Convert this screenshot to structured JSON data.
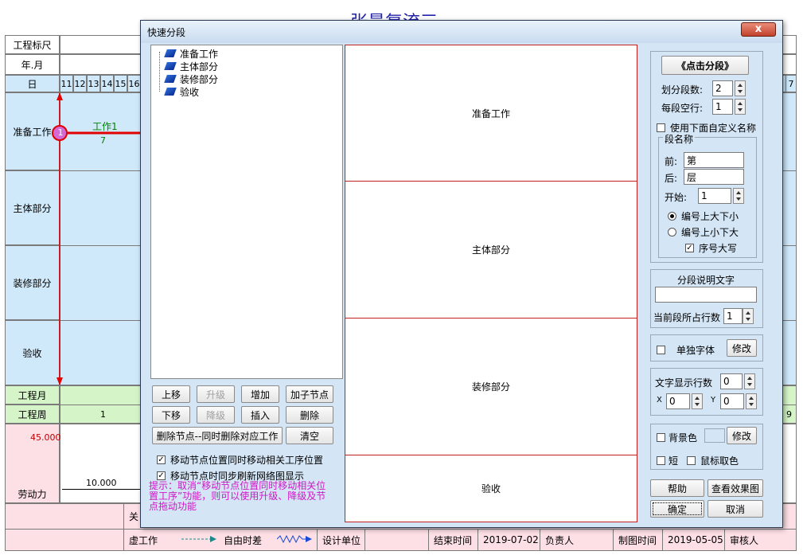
{
  "background": {
    "title": "张最复流三",
    "row_labels": [
      "工程标尺",
      "年.月",
      "日",
      "准备工作",
      "主体部分",
      "装修部分",
      "验收",
      "工程月",
      "工程周",
      "劳动力"
    ],
    "day_numbers": [
      "11",
      "12",
      "13",
      "14",
      "15",
      "16"
    ],
    "right_day": "7",
    "task": {
      "name": "工作1",
      "duration": "7",
      "node": "1"
    },
    "week_first": "1",
    "week_right": "9",
    "labor_max": "45.000",
    "labor_line": "10.000",
    "footer_left": "关",
    "footer": {
      "virtual_work": "虚工作",
      "free_float": "自由时差",
      "design_unit": "设计单位",
      "end_time_label": "结束时间",
      "end_time": "2019-07-02",
      "owner": "负责人",
      "draw_time_label": "制图时间",
      "draw_time": "2019-05-05",
      "reviewer": "审核人"
    }
  },
  "dialog": {
    "title": "快速分段",
    "close_label": "x",
    "tree_items": [
      "准备工作",
      "主体部分",
      "装修部分",
      "验收"
    ],
    "buttons": {
      "move_up": "上移",
      "upgrade": "升级",
      "add": "增加",
      "add_child": "加子节点",
      "move_down": "下移",
      "downgrade": "降级",
      "insert": "插入",
      "delete": "删除",
      "delete_node_work": "删除节点--同时删除对应工作",
      "clear": "清空"
    },
    "check_move_node": "移动节点位置同时移动相关工序位置",
    "check_sync_refresh": "移动节点时同步刷新网络图显示",
    "hint": "提示：取消“移动节点位置同时移动相关位置工序”功能，则可以使用升级、降级及节点拖动功能",
    "preview_segments": [
      "准备工作",
      "主体部分",
      "装修部分",
      "验收"
    ],
    "right": {
      "click_segment": "《点击分段》",
      "segments_label": "划分段数:",
      "segments_value": "2",
      "blank_rows_label": "每段空行:",
      "blank_rows_value": "1",
      "use_custom_names": "使用下面自定义名称",
      "segment_name_group": "段名称",
      "prefix_label": "前:",
      "prefix_value": "第",
      "suffix_label": "后:",
      "suffix_value": "层",
      "start_label": "开始:",
      "start_value": "1",
      "radio_big_top": "编号上大下小",
      "radio_small_top": "编号上小下大",
      "uppercase_seq": "序号大写",
      "desc_text_label": "分段说明文字",
      "desc_text_value": "",
      "rows_label": "当前段所占行数",
      "rows_value": "1",
      "separate_font": "单独字体",
      "modify1": "修改",
      "text_rows_label": "文字显示行数",
      "text_rows_value": "0",
      "x_label": "X",
      "x_value": "0",
      "y_label": "Y",
      "y_value": "0",
      "bg_color": "背景色",
      "modify2": "修改",
      "short": "短",
      "mouse_color": "鼠标取色",
      "help": "帮助",
      "view_effect": "查看效果图",
      "ok": "确定",
      "cancel": "取消"
    }
  }
}
